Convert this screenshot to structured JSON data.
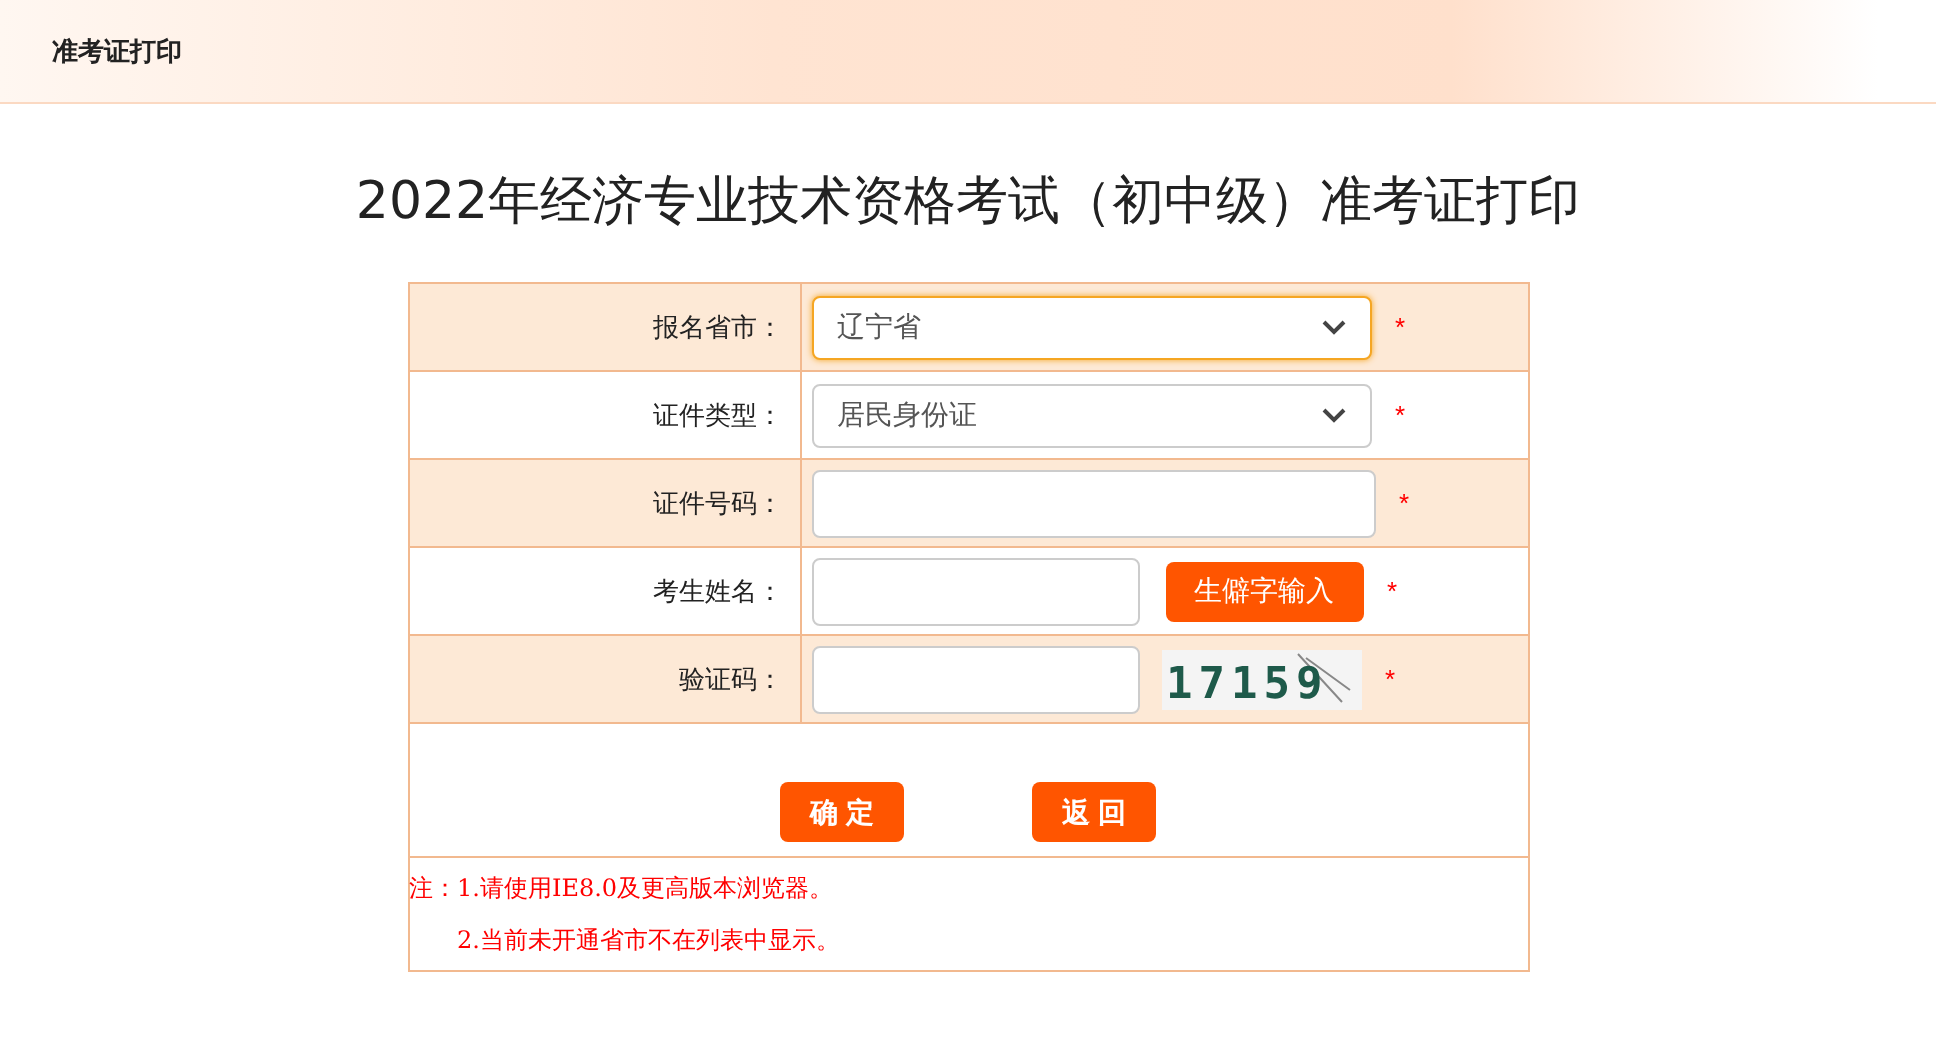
{
  "header": {
    "title": "准考证打印"
  },
  "page_title": "2022年经济专业技术资格考试（初中级）准考证打印",
  "form_rows": [
    {
      "kind": "select",
      "label": "报名省市：",
      "value": "辽宁省",
      "focused": true,
      "required": "*"
    },
    {
      "kind": "select",
      "label": "证件类型：",
      "value": "居民身份证",
      "focused": false,
      "required": "*"
    },
    {
      "kind": "input",
      "label": "证件号码：",
      "required": "*"
    },
    {
      "kind": "input_button",
      "label": "考生姓名：",
      "button": "生僻字输入",
      "required": "*"
    },
    {
      "kind": "captcha",
      "label": "验证码：",
      "captcha": "17159",
      "required": "*"
    }
  ],
  "buttons": [
    "确 定",
    "返 回"
  ],
  "notes": [
    {
      "prefix": "注：",
      "text": "1.请使用IE8.0及更高版本浏览器。"
    },
    {
      "text": "2.当前未开通省市不在列表中显示。"
    }
  ]
}
